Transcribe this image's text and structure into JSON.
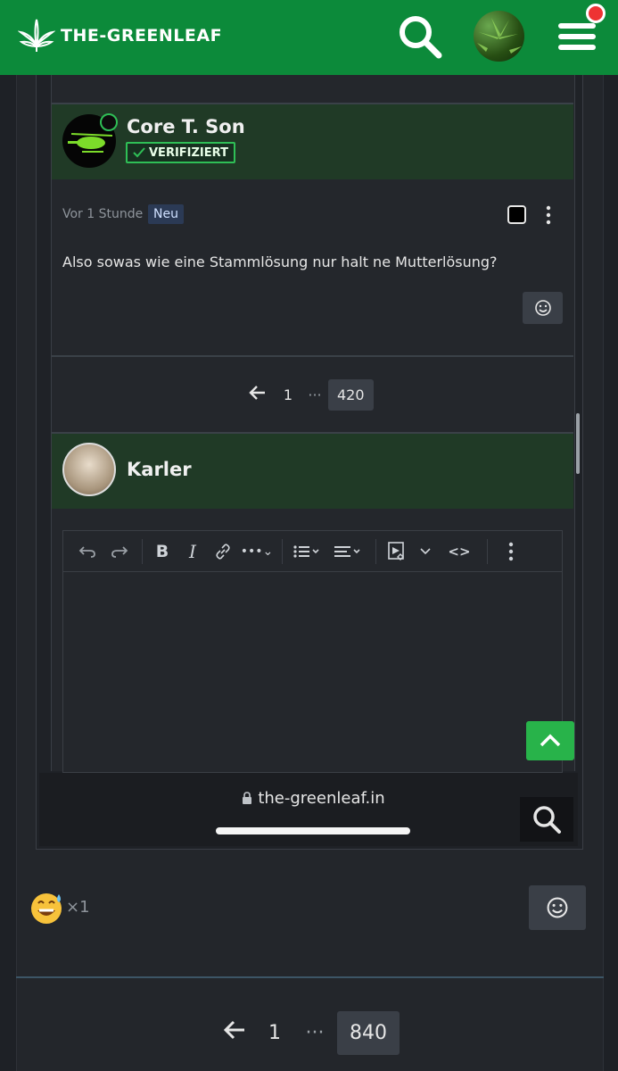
{
  "header": {
    "logo_text": "THE-GREENLEAF",
    "notification_dot_color": "#e33333",
    "brand_color": "#0c8a3a"
  },
  "post": {
    "author": "Core T. Son",
    "verified_label": "VERIFIZIERT",
    "time": "Vor 1 Stunde",
    "new_badge": "Neu",
    "text": "Also sowas wie eine Stammlösung nur halt ne Mutterlösung?"
  },
  "pagination_inner": {
    "prev_icon": "arrow-left-icon",
    "first": "1",
    "ellipsis": "···",
    "current": "420"
  },
  "reply": {
    "author": "Karler",
    "toolbar": [
      "undo-icon",
      "redo-icon",
      "bold-icon",
      "italic-icon",
      "link-icon",
      "more-icon",
      "list-icon",
      "align-icon",
      "media-icon",
      "code-icon",
      "menu-icon"
    ]
  },
  "browser": {
    "url": "the-greenleaf.in"
  },
  "reactions": {
    "emoji_icon": "grinning-sweat-emoji",
    "count": "1"
  },
  "pagination_outer": {
    "prev_icon": "arrow-left-icon",
    "first": "1",
    "ellipsis": "···",
    "current": "840"
  }
}
